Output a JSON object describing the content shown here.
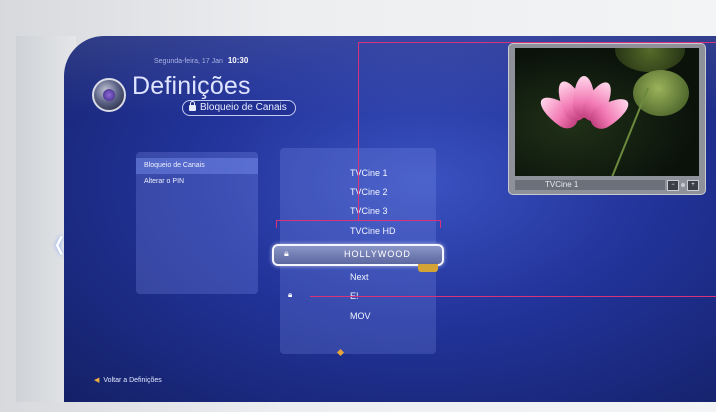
{
  "header": {
    "date": "Segunda-feira, 17 Jan",
    "time": "10:30",
    "title": "Definições",
    "breadcrumb": "Bloqueio de Canais"
  },
  "menu": {
    "items": [
      {
        "label": "Bloqueio de Canais",
        "active": true
      },
      {
        "label": "Alterar o PIN",
        "active": false
      }
    ]
  },
  "channels": [
    {
      "label": "TVCine 1",
      "locked": false
    },
    {
      "label": "TVCine 2",
      "locked": false
    },
    {
      "label": "TVCine 3",
      "locked": false
    },
    {
      "label": "TVCine HD",
      "locked": false
    },
    {
      "label": "HOLLYWOOD",
      "locked": true,
      "selected": true
    },
    {
      "label": "Next",
      "locked": false
    },
    {
      "label": "E!",
      "locked": true
    },
    {
      "label": "MOV",
      "locked": false
    }
  ],
  "preview": {
    "channel_label": "TVCine 1"
  },
  "footer": {
    "back_label": "Voltar a Definições"
  },
  "colors": {
    "background_blue": "#22339a",
    "callout_line": "#d8327d",
    "highlight_gold": "#d3a335"
  }
}
